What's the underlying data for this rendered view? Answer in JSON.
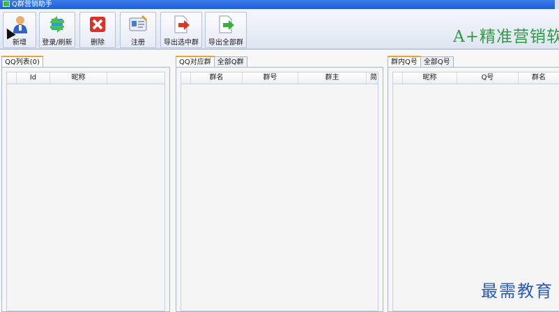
{
  "window": {
    "title": "Q群营销助手"
  },
  "toolbar": {
    "buttons": [
      {
        "label": "新增",
        "icon": "user-add-icon"
      },
      {
        "label": "登录/刷新",
        "icon": "refresh-icon"
      },
      {
        "label": "删除",
        "icon": "delete-icon"
      },
      {
        "label": "注册",
        "icon": "register-card-icon"
      },
      {
        "label": "导出选中群",
        "icon": "export-selected-icon"
      },
      {
        "label": "导出全部群",
        "icon": "export-all-icon"
      }
    ],
    "brand": "A+精准营销软件"
  },
  "panels": {
    "qq_list": {
      "tabs": [
        "QQ列表(0)"
      ],
      "columns": [
        "",
        "Id",
        "昵称",
        ""
      ]
    },
    "groups": {
      "tabs": [
        "QQ对应群",
        "全部Q群"
      ],
      "columns": [
        "",
        "群名",
        "群号",
        "群主",
        "简"
      ]
    },
    "members": {
      "tabs": [
        "群内Q号",
        "全部Q号"
      ],
      "columns": [
        "",
        "昵称",
        "Q号",
        "群名"
      ]
    }
  },
  "watermark": "最需教育",
  "colors": {
    "brand_green": "#2f9a43",
    "title_blue": "#1f5fd6",
    "active_tab_accent": "#f0a030",
    "watermark_blue": "#2a5ab8"
  }
}
